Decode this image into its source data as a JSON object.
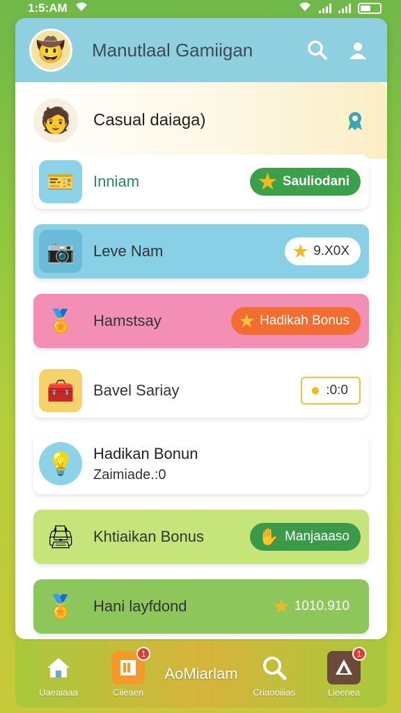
{
  "status_bar": {
    "time": "1:5:AM"
  },
  "header": {
    "title": "Manutlaal Gamiigan"
  },
  "sub_header": {
    "title": "Casual daiaga)"
  },
  "rows": [
    {
      "label": "Inniam",
      "badge": "Sauliodani",
      "bg": "#ffffff",
      "badge_bg": "#3aa04a",
      "badge_color": "#ffffff",
      "icon_bg": "#8cd3e8"
    },
    {
      "label": "Leve Nam",
      "badge": "9.X0X",
      "bg": "#88d0e6",
      "badge_bg": "#ffffff",
      "badge_color": "#333333",
      "icon_bg": "#6bbbd8"
    },
    {
      "label": "Hamstsay",
      "badge": "Hadikah Bonus",
      "bg": "#f38fb4",
      "badge_bg": "#f26d2f",
      "badge_color": "#ffffff",
      "icon_bg": "#f38fb4"
    },
    {
      "label": "Bavel Sariay",
      "badge": ":0:0",
      "bg": "#ffffff",
      "badge_bg": "#ffffff",
      "badge_color": "#333333",
      "icon_bg": "#f6d36a"
    },
    {
      "label": "Hadikan Bonun",
      "sublabel": "Zaimiade.:0",
      "bg": "#ffffff",
      "icon_bg": "#8cd3e8"
    },
    {
      "label": "Khtiaikan Bonus",
      "badge": "Manjaaaso",
      "bg": "#c5e47a",
      "badge_bg": "#3a9a4a",
      "badge_color": "#ffffff",
      "icon_bg": "#c5e47a"
    },
    {
      "label": "Hani layfdond",
      "badge": "1010.910",
      "bg": "#8dc65a",
      "badge_bg": "#8dc65a",
      "badge_color": "#ffffff",
      "icon_bg": "#8dc65a"
    }
  ],
  "tabbar": {
    "tab1": "Uaeaiaaa",
    "tab2": "Ciieaen",
    "center": "AoMiarlam",
    "tab3": "Criaooiiias",
    "tab4": "Lieenea",
    "badge2": "1",
    "badge4": "1"
  }
}
